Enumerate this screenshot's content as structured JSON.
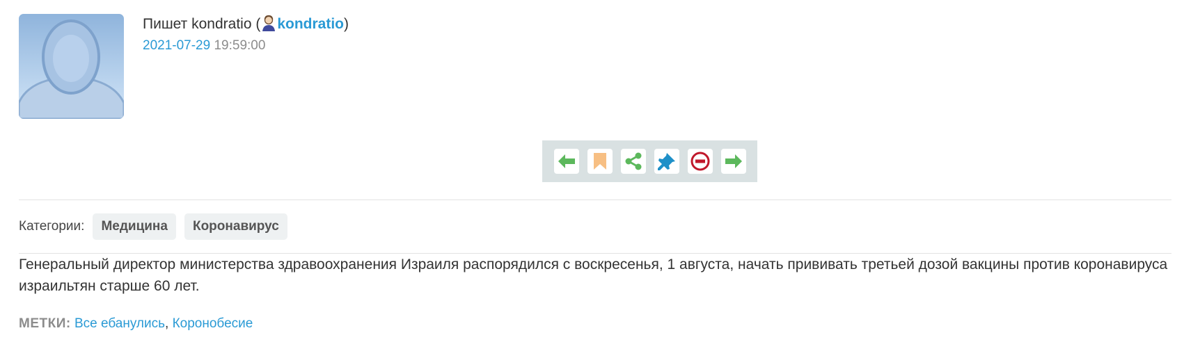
{
  "post": {
    "author_prefix": "Пишет kondratio (",
    "author_user": "kondratio",
    "author_suffix": ")",
    "date": "2021-07-29",
    "time": "19:59:00"
  },
  "toolbar": {
    "buttons": [
      {
        "name": "prev",
        "icon": "arrow-left-icon",
        "color": "#5cb85c"
      },
      {
        "name": "bookmark",
        "icon": "bookmark-icon",
        "color": "#f7bf83"
      },
      {
        "name": "share",
        "icon": "share-icon",
        "color": "#5cb85c"
      },
      {
        "name": "pin",
        "icon": "pin-icon",
        "color": "#1e90c8"
      },
      {
        "name": "block",
        "icon": "minus-circle-icon",
        "color": "#c0182b"
      },
      {
        "name": "next",
        "icon": "arrow-right-icon",
        "color": "#5cb85c"
      }
    ]
  },
  "categories": {
    "label": "Категории:",
    "items": [
      "Медицина",
      "Коронавирус"
    ]
  },
  "body": {
    "text": "Генеральный директор министерства здравоохранения Израиля распорядился с воскресенья, 1 августа, начать прививать третьей дозой вакцины против коронавируса израильтян старше 60 лет."
  },
  "tags": {
    "label": "МЕТКИ:",
    "items": [
      "Все ебанулись",
      "Коронобесие"
    ],
    "separator": ", "
  },
  "colors": {
    "link": "#2a9ad5",
    "toolbar_bg": "#d9e1e2",
    "chip_bg": "#eef1f2"
  }
}
